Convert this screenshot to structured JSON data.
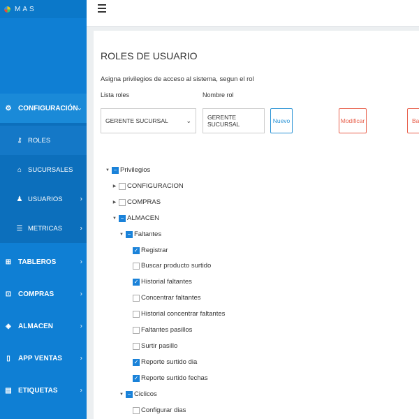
{
  "brand": {
    "name": "MAS"
  },
  "sidebar": {
    "config": {
      "label": "CONFIGURACIÓN"
    },
    "sub_items": [
      {
        "label": "ROLES",
        "icon": "key-icon",
        "glyph": "⚷",
        "active": true,
        "chevron": false
      },
      {
        "label": "SUCURSALES",
        "icon": "home-icon",
        "glyph": "⌂",
        "active": false,
        "chevron": false
      },
      {
        "label": "USUARIOS",
        "icon": "user-icon",
        "glyph": "♟",
        "active": false,
        "chevron": true
      },
      {
        "label": "METRICAS",
        "icon": "list-icon",
        "glyph": "☰",
        "active": false,
        "chevron": true
      }
    ],
    "items": [
      {
        "label": "TABLEROS",
        "icon": "windows-icon",
        "glyph": "⊞"
      },
      {
        "label": "COMPRAS",
        "icon": "cart-icon",
        "glyph": "⊡"
      },
      {
        "label": "ALMACEN",
        "icon": "cube-icon",
        "glyph": "◈"
      },
      {
        "label": "APP VENTAS",
        "icon": "mobile-icon",
        "glyph": "▯"
      },
      {
        "label": "ETIQUETAS",
        "icon": "tag-icon",
        "glyph": "▤"
      }
    ]
  },
  "page": {
    "title": "ROLES DE USUARIO",
    "description": "Asigna privilegios de acceso al sistema, segun el rol",
    "lista_label": "Lista roles",
    "nombre_label": "Nombre rol",
    "selected_role": "GERENTE SUCURSAL",
    "role_name": "GERENTE SUCURSAL",
    "nuevo_label": "Nuevo",
    "modificar_label": "Modificar",
    "baja_label": "Baja"
  },
  "tree": [
    {
      "label": "Privilegios",
      "level": 0,
      "toggle": "open",
      "state": "partial"
    },
    {
      "label": "CONFIGURACION",
      "level": 1,
      "toggle": "closed",
      "state": "unchecked"
    },
    {
      "label": "COMPRAS",
      "level": 1,
      "toggle": "closed",
      "state": "unchecked"
    },
    {
      "label": "ALMACEN",
      "level": 1,
      "toggle": "open",
      "state": "partial"
    },
    {
      "label": "Faltantes",
      "level": 2,
      "toggle": "open",
      "state": "partial"
    },
    {
      "label": "Registrar",
      "level": 3,
      "toggle": "none",
      "state": "checked"
    },
    {
      "label": "Buscar producto surtido",
      "level": 3,
      "toggle": "none",
      "state": "unchecked"
    },
    {
      "label": "Historial faltantes",
      "level": 3,
      "toggle": "none",
      "state": "checked"
    },
    {
      "label": "Concentrar faltantes",
      "level": 3,
      "toggle": "none",
      "state": "unchecked"
    },
    {
      "label": "Historial concentrar faltantes",
      "level": 3,
      "toggle": "none",
      "state": "unchecked"
    },
    {
      "label": "Faltantes pasillos",
      "level": 3,
      "toggle": "none",
      "state": "unchecked"
    },
    {
      "label": "Surtir pasillo",
      "level": 3,
      "toggle": "none",
      "state": "unchecked"
    },
    {
      "label": "Reporte surtido dia",
      "level": 3,
      "toggle": "none",
      "state": "checked"
    },
    {
      "label": "Reporte surtido fechas",
      "level": 3,
      "toggle": "none",
      "state": "checked"
    },
    {
      "label": "Ciclicos",
      "level": 2,
      "toggle": "open",
      "state": "partial"
    },
    {
      "label": "Configurar dias",
      "level": 3,
      "toggle": "none",
      "state": "unchecked"
    }
  ]
}
